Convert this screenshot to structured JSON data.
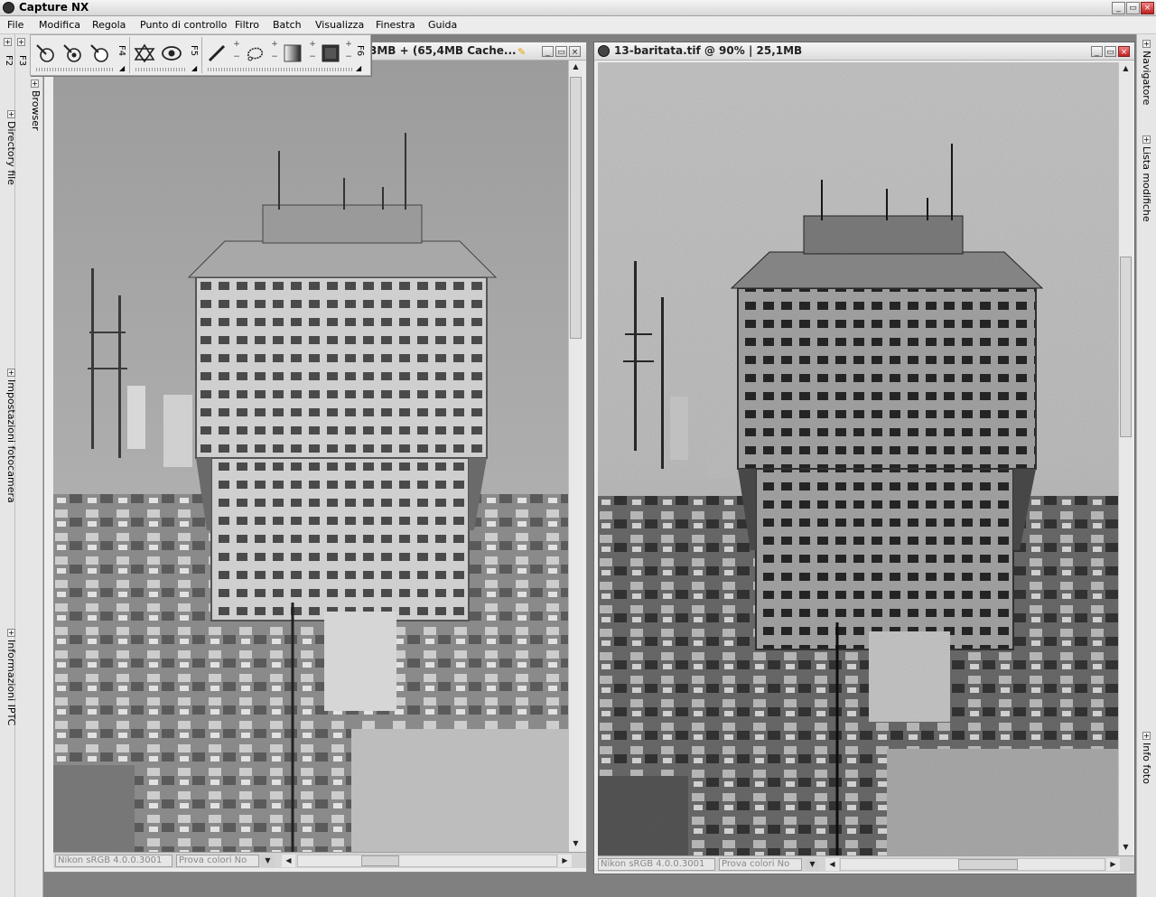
{
  "app": {
    "title": "Capture NX"
  },
  "window_buttons": {
    "minimize": "_",
    "restore": "▭",
    "close": "×"
  },
  "menu": [
    "File",
    "Modifica",
    "Regola",
    "Punto di controllo",
    "Filtro",
    "Batch",
    "Visualizza",
    "Finestra",
    "Guida"
  ],
  "left_dock": {
    "fkeys": [
      "F2",
      "F3"
    ],
    "panels": [
      "Browser",
      "Directory file",
      "Impostazioni fotocamera",
      "Informazioni IPTC"
    ]
  },
  "right_dock": {
    "panels": [
      "Navigatore",
      "Lista modifiche",
      "Info foto"
    ]
  },
  "toolbar": {
    "fkeys": [
      "F4",
      "F5",
      "F6"
    ],
    "plus": "+",
    "minus": "−",
    "tools": [
      "control-point-icon",
      "red-eye-point-icon",
      "white-point-icon",
      "crop-icon",
      "red-eye-icon",
      "brush-icon",
      "lasso-icon",
      "gradient-icon",
      "fill-icon"
    ]
  },
  "left_window": {
    "title_fragment": "3MB + (65,4MB Cache...",
    "status": {
      "profile": "Nikon sRGB 4.0.0.3001",
      "proof": "Prova colori No"
    },
    "vscroll_fraction": 0.35,
    "hscroll_fraction": 0.4
  },
  "right_window": {
    "title": "13-baritata.tif @ 90% | 25,1MB",
    "status": {
      "profile": "Nikon sRGB 4.0.0.3001",
      "proof": "Prova colori No"
    },
    "vscroll_fraction": 0.3,
    "hscroll_fraction": 0.45
  }
}
